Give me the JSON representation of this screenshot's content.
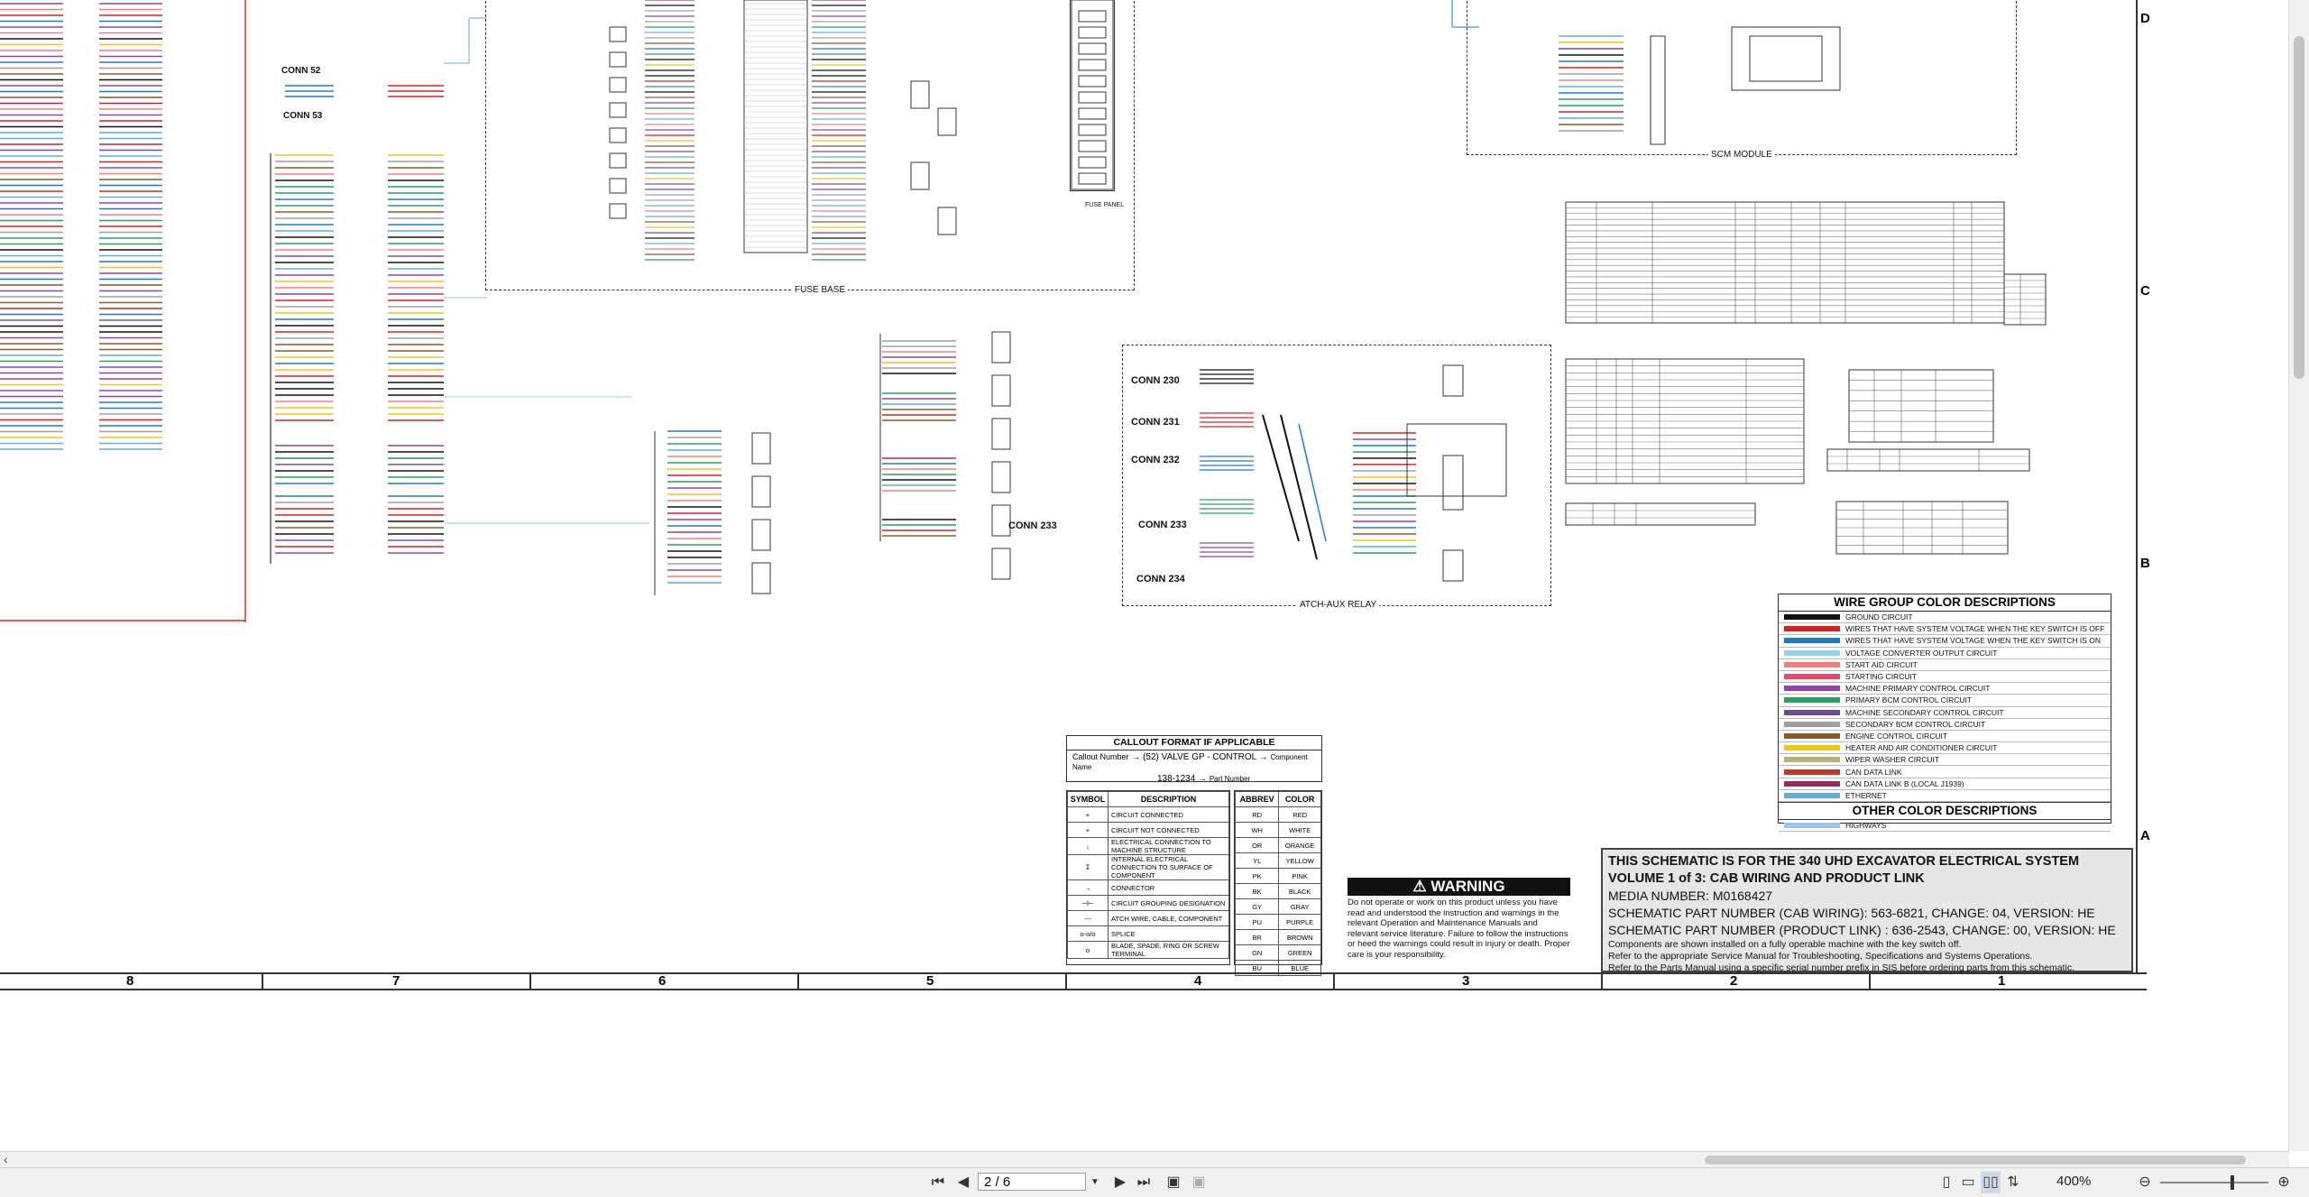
{
  "schematic": {
    "connectors": [
      "CONN 52",
      "CONN 53",
      "CONN 230",
      "CONN 231",
      "CONN 232",
      "CONN 233",
      "CONN 234",
      "CONN 233"
    ],
    "boxes": {
      "fuse_base": "FUSE BASE",
      "fuse_panel": "FUSE PANEL",
      "atch_aux_relay": "ATCH-AUX RELAY",
      "scm_module": "SCM MODULE"
    },
    "columns": [
      "8",
      "7",
      "6",
      "5",
      "4",
      "3",
      "2",
      "1"
    ],
    "rows": [
      "D",
      "C",
      "B",
      "A"
    ]
  },
  "legend": {
    "title": "WIRE GROUP COLOR DESCRIPTIONS",
    "items": [
      {
        "label": "GROUND CIRCUIT",
        "color": "#111111"
      },
      {
        "label": "WIRES THAT HAVE SYSTEM VOLTAGE WHEN THE KEY SWITCH IS OFF",
        "color": "#d62020"
      },
      {
        "label": "WIRES THAT HAVE SYSTEM VOLTAGE WHEN THE KEY SWITCH IS ON",
        "color": "#1f78c8"
      },
      {
        "label": "VOLTAGE CONVERTER OUTPUT CIRCUIT",
        "color": "#8fd3f0"
      },
      {
        "label": "START AID CIRCUIT",
        "color": "#f08080"
      },
      {
        "label": "STARTING CIRCUIT",
        "color": "#e34a6b"
      },
      {
        "label": "MACHINE PRIMARY CONTROL CIRCUIT",
        "color": "#8e44ad"
      },
      {
        "label": "PRIMARY BCM CONTROL CIRCUIT",
        "color": "#27a060"
      },
      {
        "label": "MACHINE SECONDARY CONTROL CIRCUIT",
        "color": "#6a4c93"
      },
      {
        "label": "SECONDARY BCM CONTROL CIRCUIT",
        "color": "#a0a0a0"
      },
      {
        "label": "ENGINE CONTROL CIRCUIT",
        "color": "#8b5a2b"
      },
      {
        "label": "HEATER AND AIR CONDITIONER CIRCUIT",
        "color": "#f0c419"
      },
      {
        "label": "WIPER WASHER CIRCUIT",
        "color": "#b8b070"
      },
      {
        "label": "CAN DATA LINK",
        "color": "#c0392b"
      },
      {
        "label": "CAN DATA LINK B (LOCAL J1939)",
        "color": "#922b60"
      },
      {
        "label": "ETHERNET",
        "color": "#5dade2"
      }
    ],
    "other_title": "OTHER COLOR DESCRIPTIONS",
    "other_items": [
      {
        "label": "HIGHWAYS",
        "color": "#9ec4ea"
      }
    ]
  },
  "callout": {
    "title": "CALLOUT FORMAT IF APPLICABLE",
    "label": "Callout Number",
    "example": "(52) VALVE GP - CONTROL",
    "part": "138-1234",
    "component": "Component Name",
    "part_number": "Part Number"
  },
  "symbols": {
    "header_symbol": "SYMBOL",
    "header_desc": "DESCRIPTION",
    "rows": [
      {
        "sym": "+",
        "desc": "CIRCUIT CONNECTED"
      },
      {
        "sym": "+",
        "desc": "CIRCUIT NOT CONNECTED"
      },
      {
        "sym": "↓",
        "desc": "ELECTRICAL CONNECTION TO MACHINE STRUCTURE"
      },
      {
        "sym": "↧",
        "desc": "INTERNAL ELECTRICAL CONNECTION TO SURFACE OF COMPONENT"
      },
      {
        "sym": "→",
        "desc": "CONNECTOR"
      },
      {
        "sym": "⊣⊢",
        "desc": "CIRCUIT GROUPING DESIGNATION"
      },
      {
        "sym": "---",
        "desc": "ATCH WIRE, CABLE, COMPONENT"
      },
      {
        "sym": "o-o/o",
        "desc": "SPLICE"
      },
      {
        "sym": "o",
        "desc": "BLADE, SPADE, RING OR SCREW TERMINAL"
      }
    ]
  },
  "colors": {
    "header_abbrev": "ABBREV",
    "header_color": "COLOR",
    "rows": [
      [
        "RD",
        "RED"
      ],
      [
        "WH",
        "WHITE"
      ],
      [
        "OR",
        "ORANGE"
      ],
      [
        "YL",
        "YELLOW"
      ],
      [
        "PK",
        "PINK"
      ],
      [
        "BK",
        "BLACK"
      ],
      [
        "GY",
        "GRAY"
      ],
      [
        "PU",
        "PURPLE"
      ],
      [
        "BR",
        "BROWN"
      ],
      [
        "GN",
        "GREEN"
      ],
      [
        "BU",
        "BLUE"
      ]
    ]
  },
  "warning": {
    "title": "WARNING",
    "text": "Do not operate or work on this product unless you have read and understood the instruction and warnings in the relevant Operation and Maintenance Manuals and relevant service literature. Failure to follow the instructions or heed the warnings could result in injury or death. Proper care is your responsibility."
  },
  "title_block": {
    "line1": "THIS SCHEMATIC IS FOR THE 340 UHD EXCAVATOR ELECTRICAL SYSTEM",
    "line2": "VOLUME 1 of 3: CAB WIRING AND PRODUCT LINK",
    "line3": "MEDIA NUMBER: M0168427",
    "line4": "SCHEMATIC PART NUMBER (CAB WIRING): 563-6821, CHANGE: 04, VERSION: HE",
    "line5": "SCHEMATIC PART NUMBER (PRODUCT LINK) : 636-2543, CHANGE: 00, VERSION: HE",
    "line6": "Components are shown installed on a fully operable machine with the key switch off.",
    "line7": "Refer to the appropriate Service Manual for Troubleshooting, Specifications and Systems Operations.",
    "line8": "Refer to the Parts Manual using a specific serial number prefix in SIS before ordering parts from this schematic."
  },
  "toolbar": {
    "page": "2 / 6",
    "zoom": "400%",
    "first": "⏮",
    "prev": "◀",
    "next": "▶",
    "last": "⏭",
    "zoom_out": "⊖",
    "zoom_in": "⊕"
  }
}
